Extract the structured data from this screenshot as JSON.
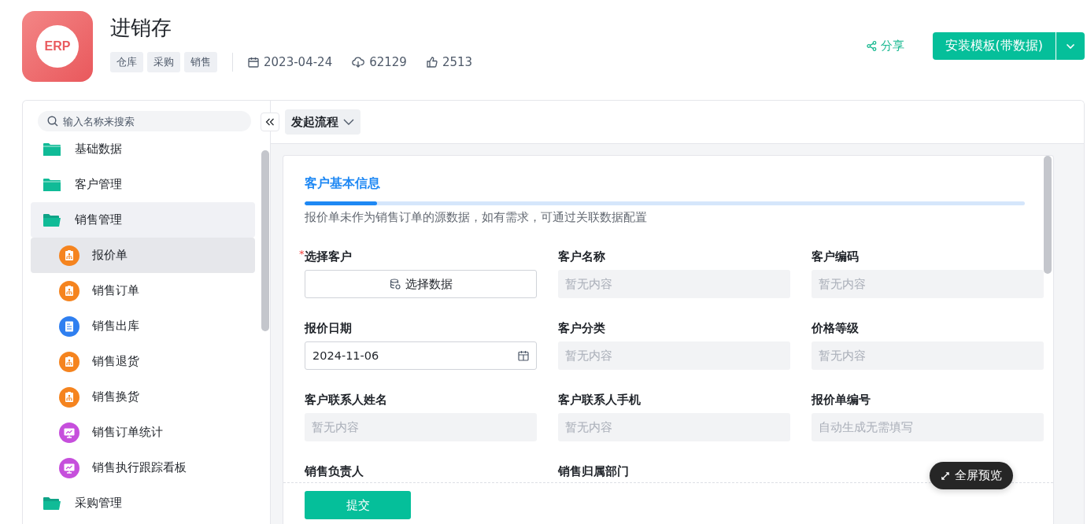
{
  "app": {
    "logo_text": "ERP",
    "title": "进销存",
    "tags": [
      "仓库",
      "采购",
      "销售"
    ],
    "date": "2023-04-24",
    "downloads": "62129",
    "likes": "2513"
  },
  "actions": {
    "share": "分享",
    "install": "安装模板(带数据)"
  },
  "sidebar": {
    "search": {
      "placeholder": "输入名称来搜索"
    },
    "items": [
      {
        "label": "基础数据",
        "expanded": false
      },
      {
        "label": "客户管理",
        "expanded": false
      },
      {
        "label": "销售管理",
        "expanded": true,
        "children": [
          {
            "label": "报价单",
            "kind": "org",
            "color": "#f5841f",
            "selected": true
          },
          {
            "label": "销售订单",
            "kind": "org",
            "color": "#f5841f",
            "selected": false
          },
          {
            "label": "销售出库",
            "kind": "doc",
            "color": "#2f7ff0",
            "selected": false
          },
          {
            "label": "销售退货",
            "kind": "org",
            "color": "#f5841f",
            "selected": false
          },
          {
            "label": "销售换货",
            "kind": "org",
            "color": "#f5841f",
            "selected": false
          },
          {
            "label": "销售订单统计",
            "kind": "chart",
            "color": "#c64fdc",
            "selected": false
          },
          {
            "label": "销售执行跟踪看板",
            "kind": "chart",
            "color": "#c64fdc",
            "selected": false
          }
        ]
      },
      {
        "label": "采购管理",
        "expanded": true
      }
    ]
  },
  "toolbar": {
    "flow_button": "发起流程"
  },
  "form": {
    "section": {
      "title": "客户基本信息",
      "level": 0.1
    },
    "description": "报价单未作为销售订单的源数据，如有需求，可通过关联数据配置",
    "fields": [
      {
        "label": "选择客户",
        "required_mark": "*",
        "kind": "picker",
        "value": "选择数据"
      },
      {
        "label": "客户名称",
        "kind": "readonly",
        "placeholder": "暂无内容"
      },
      {
        "label": "客户编码",
        "kind": "readonly",
        "placeholder": "暂无内容"
      },
      {
        "label": "报价日期",
        "kind": "date",
        "value": "2024-11-06"
      },
      {
        "label": "客户分类",
        "kind": "readonly",
        "placeholder": "暂无内容"
      },
      {
        "label": "价格等级",
        "kind": "readonly",
        "placeholder": "暂无内容"
      },
      {
        "label": "客户联系人姓名",
        "kind": "readonly",
        "placeholder": "暂无内容"
      },
      {
        "label": "客户联系人手机",
        "kind": "readonly",
        "placeholder": "暂无内容"
      },
      {
        "label": "报价单编号",
        "kind": "readonly",
        "placeholder": "自动生成无需填写"
      },
      {
        "label": "销售负责人",
        "kind": "hidden"
      },
      {
        "label": "销售归属部门",
        "kind": "hidden"
      }
    ],
    "submit": "提交",
    "fullscreen": "全屏预览"
  }
}
